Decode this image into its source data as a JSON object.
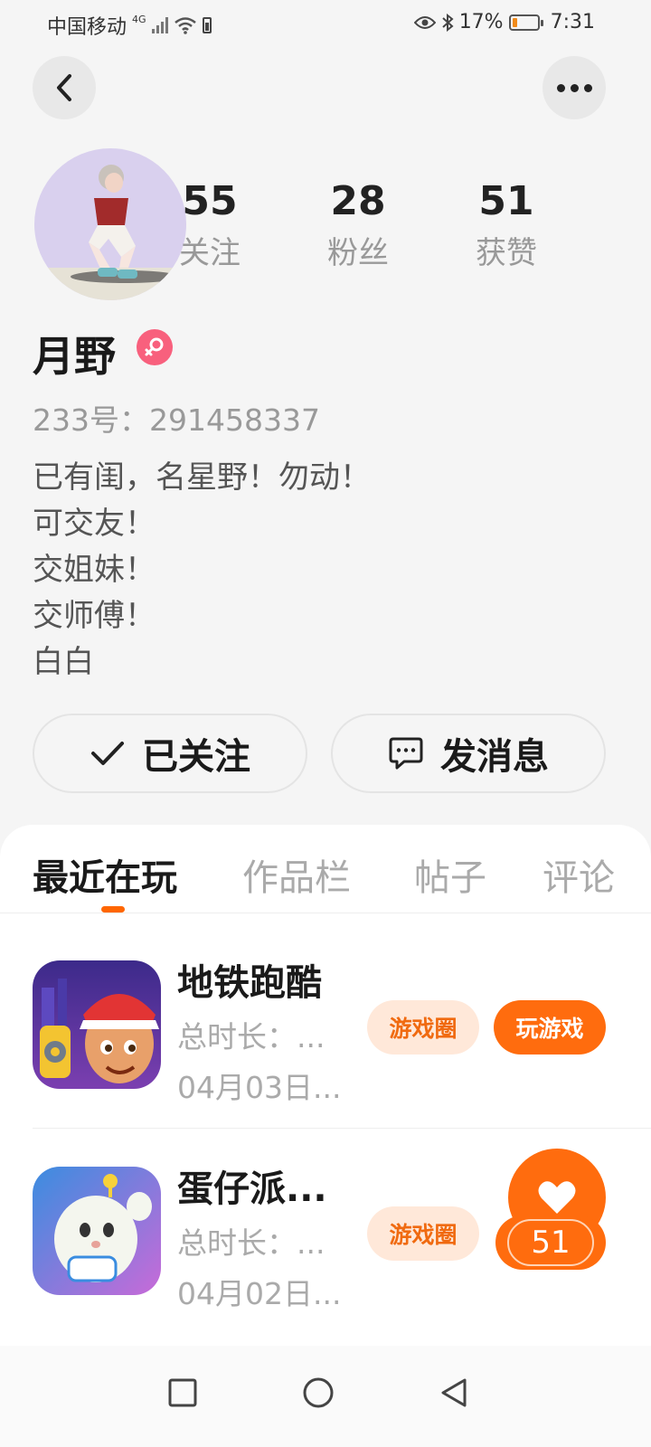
{
  "status_bar": {
    "carrier": "中国移动",
    "network": "4G",
    "battery_percent": "17%",
    "time": "7:31",
    "battery_level": 0.17
  },
  "header": {
    "back_icon": "chevron-left-icon",
    "more_icon": "more-dots-icon"
  },
  "profile": {
    "stats": [
      {
        "value": "55",
        "label": "关注"
      },
      {
        "value": "28",
        "label": "粉丝"
      },
      {
        "value": "51",
        "label": "获赞"
      }
    ],
    "name": "月野",
    "gender_icon": "female-icon",
    "uid": "233号：291458337",
    "bio": [
      "已有闺，名星野！勿动！",
      "可交友！",
      "交姐妹！",
      "交师傅！",
      "白白"
    ]
  },
  "actions": {
    "follow_label": "已关注",
    "message_label": "发消息"
  },
  "tabs": [
    {
      "label": "最近在玩",
      "active": true
    },
    {
      "label": "作品栏",
      "active": false
    },
    {
      "label": "帖子",
      "active": false
    },
    {
      "label": "评论",
      "active": false
    }
  ],
  "games": [
    {
      "title": "地铁跑酷",
      "time": "总时长：...",
      "date": "04月03日...",
      "circle_label": "游戏圈",
      "play_label": "玩游戏"
    },
    {
      "title": "蛋仔派...",
      "time": "总时长：...",
      "date": "04月02日...",
      "circle_label": "游戏圈",
      "like_count": "51"
    }
  ],
  "colors": {
    "accent": "#ff6c0e",
    "accent_light": "#ffe8d9",
    "gender_badge": "#f8607d"
  }
}
